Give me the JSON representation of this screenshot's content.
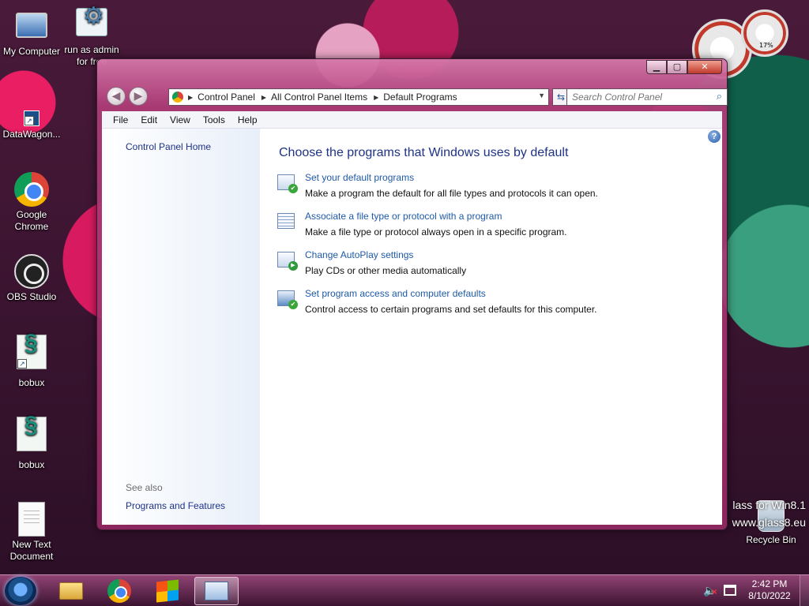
{
  "desktop": {
    "icons": [
      {
        "label": "My Computer"
      },
      {
        "label": "run as admin for free"
      },
      {
        "label": "DataWagon..."
      },
      {
        "label": "Google Chrome"
      },
      {
        "label": "OBS Studio"
      },
      {
        "label": "bobux"
      },
      {
        "label": "bobux"
      },
      {
        "label": "New Text Document"
      },
      {
        "label": "Recycle Bin"
      }
    ],
    "watermark_line1": "lass for Win8.1",
    "watermark_line2": "www.glass8.eu",
    "gadget_percent": "17%"
  },
  "window": {
    "controls": {
      "minimize": "▁",
      "maximize": "▢",
      "close": "✕"
    },
    "address": {
      "crumbs": [
        "Control Panel",
        "All Control Panel Items",
        "Default Programs"
      ]
    },
    "search": {
      "placeholder": "Search Control Panel"
    },
    "menu": [
      "File",
      "Edit",
      "View",
      "Tools",
      "Help"
    ],
    "left_pane": {
      "home_link": "Control Panel Home",
      "see_also_label": "See also",
      "see_also_links": [
        "Programs and Features"
      ]
    },
    "main": {
      "title": "Choose the programs that Windows uses by default",
      "tasks": [
        {
          "link": "Set your default programs",
          "desc": "Make a program the default for all file types and protocols it can open.",
          "icon": "default-programs-icon"
        },
        {
          "link": "Associate a file type or protocol with a program",
          "desc": "Make a file type or protocol always open in a specific program.",
          "icon": "file-association-icon"
        },
        {
          "link": "Change AutoPlay settings",
          "desc": "Play CDs or other media automatically",
          "icon": "autoplay-icon"
        },
        {
          "link": "Set program access and computer defaults",
          "desc": "Control access to certain programs and set defaults for this computer.",
          "icon": "program-access-icon"
        }
      ]
    }
  },
  "taskbar": {
    "clock_time": "2:42 PM",
    "clock_date": "8/10/2022"
  }
}
